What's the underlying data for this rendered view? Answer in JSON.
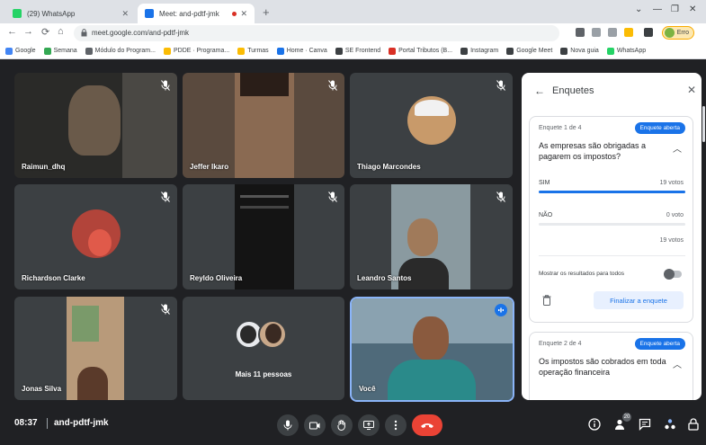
{
  "browser": {
    "tabs": [
      {
        "title": "(29) WhatsApp",
        "favicon_color": "#25d366"
      },
      {
        "title": "Meet: and-pdtf-jmk",
        "favicon_color": "#1a73e8",
        "active": true
      }
    ],
    "url": "meet.google.com/and-pdtf-jmk",
    "profile_label": "Erro",
    "bookmarks": [
      {
        "label": "Google",
        "color": "#4285f4"
      },
      {
        "label": "Semana",
        "color": "#34a853"
      },
      {
        "label": "Módulo do Program...",
        "color": "#5f6368"
      },
      {
        "label": "PDDE · Programa...",
        "color": "#fbbc04"
      },
      {
        "label": "Turmas",
        "color": "#fbbc04"
      },
      {
        "label": "Home · Canva",
        "color": "#1a73e8"
      },
      {
        "label": "SE Frontend",
        "color": "#3c4043"
      },
      {
        "label": "Portal Tributos (B...",
        "color": "#d93025"
      },
      {
        "label": "Instagram",
        "color": "#3c4043"
      },
      {
        "label": "Google Meet",
        "color": "#3c4043"
      },
      {
        "label": "Nova guia",
        "color": "#3c4043"
      },
      {
        "label": "WhatsApp",
        "color": "#25d366"
      }
    ]
  },
  "participants": [
    {
      "name": "Raimun_dhq",
      "bg": "#2a2a28",
      "type": "video"
    },
    {
      "name": "Jeffer Ikaro",
      "bg": "#5a4a3e",
      "type": "video"
    },
    {
      "name": "Thiago Marcondes",
      "bg": "#3c4043",
      "type": "avatar",
      "avatar_color": "#c89a6a"
    },
    {
      "name": "Richardson Clarke",
      "bg": "#3c4043",
      "type": "avatar",
      "avatar_color": "#b2443a"
    },
    {
      "name": "Reyldo Oliveira",
      "bg": "#1c1c1c",
      "type": "video"
    },
    {
      "name": "Leandro Santos",
      "bg": "#8a9aa0",
      "type": "video"
    },
    {
      "name": "Jonas Silva",
      "bg": "#6a4a4a",
      "type": "video"
    },
    {
      "name": "Mais 11 pessoas",
      "bg": "#3c4043",
      "type": "group"
    },
    {
      "name": "Você",
      "bg": "#4f6a7a",
      "type": "self"
    }
  ],
  "meeting": {
    "time": "08:37",
    "code": "and-pdtf-jmk"
  },
  "panel": {
    "title": "Enquetes",
    "polls": [
      {
        "index": "Enquete 1 de 4",
        "status": "Enquete aberta",
        "question": "As empresas são obrigadas a pagarem os impostos?",
        "options": [
          {
            "label": "SIM",
            "votes": "19 votos",
            "share": 1.0
          },
          {
            "label": "NÃO",
            "votes": "0 voto",
            "share": 0.0
          }
        ],
        "total": "19 votos",
        "toggle_label": "Mostrar os resultados para todos",
        "end_button": "Finalizar a enquete"
      },
      {
        "index": "Enquete 2 de 4",
        "status": "Enquete aberta",
        "question": "Os impostos são cobrados em toda operação financeira"
      }
    ]
  },
  "colors": {
    "accent": "#1a73e8",
    "end_call": "#ea4335",
    "meet_bg": "#202124",
    "tile_bg": "#3c4043"
  }
}
